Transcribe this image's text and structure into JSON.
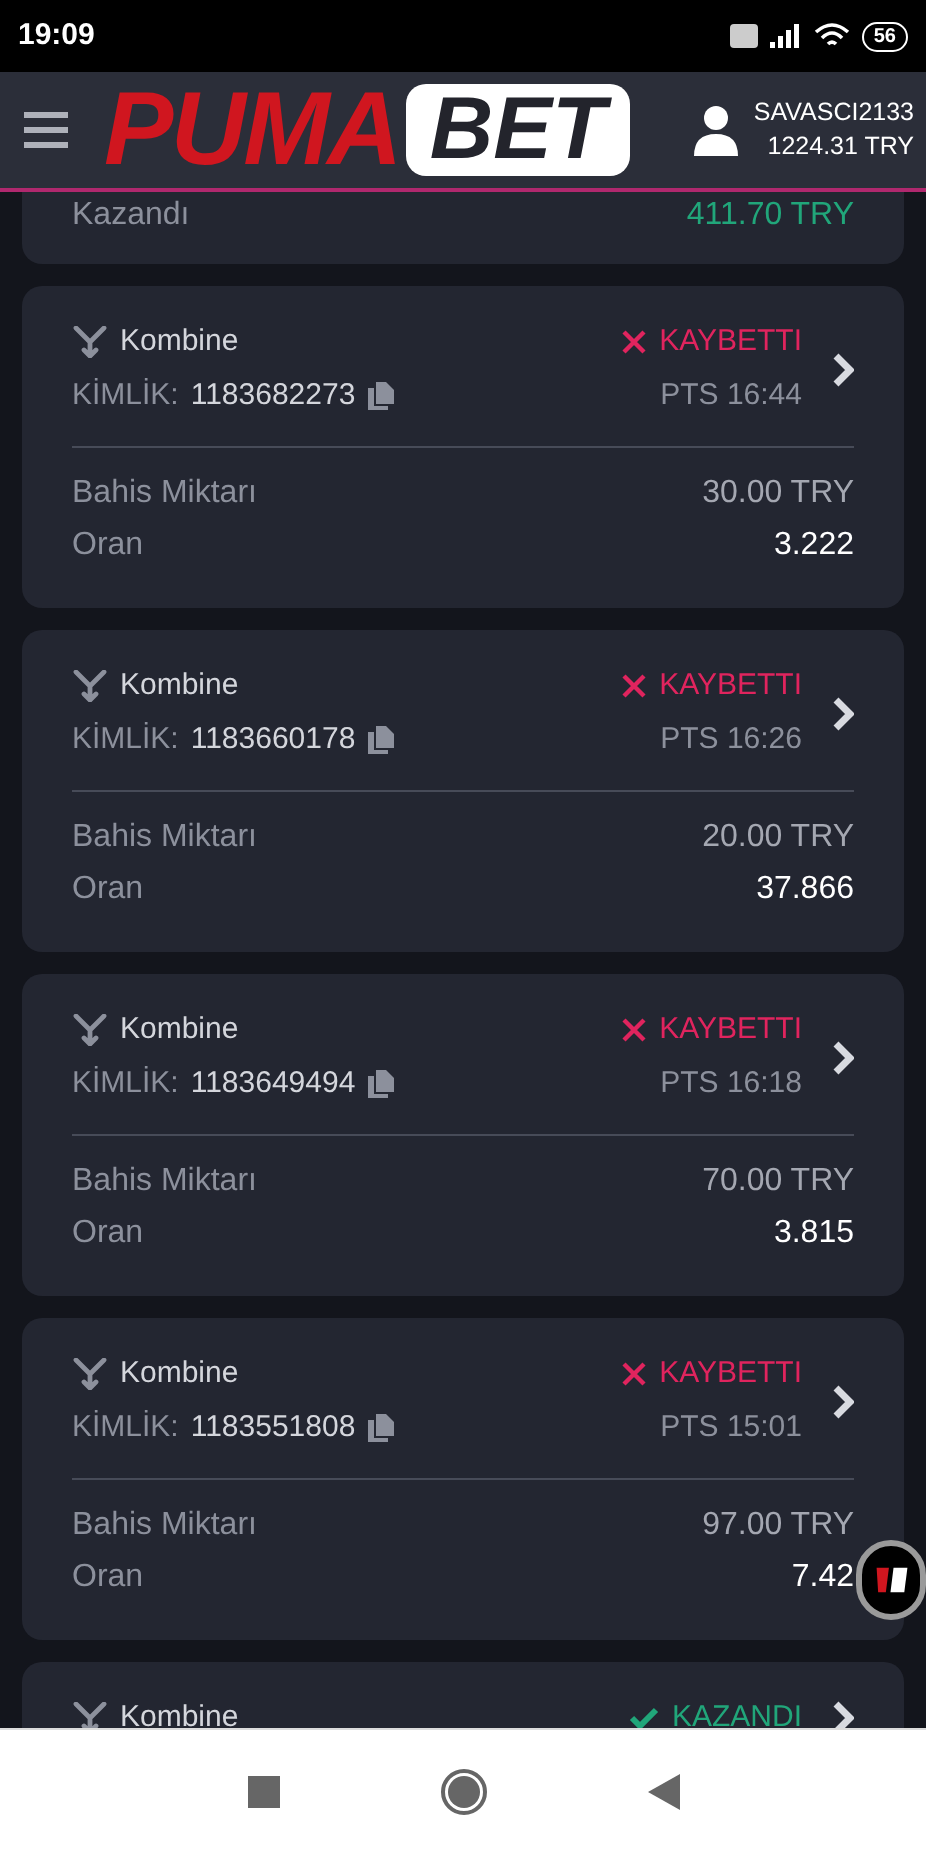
{
  "status_bar": {
    "time": "19:09",
    "battery": "56"
  },
  "header": {
    "logo_left": "PUMA",
    "logo_right": "BET",
    "username": "SAVASCI2133",
    "balance": "1224.31 TRY"
  },
  "previous_card": {
    "label": "Kazandı",
    "value": "411.70 TRY"
  },
  "bets": [
    {
      "type": "Kombine",
      "id_label": "KİMLİK:",
      "id": "1183682273",
      "kind": "lost",
      "status_text": "KAYBETTI",
      "time": "PTS 16:44",
      "stake_label": "Bahis Miktarı",
      "stake": "30.00 TRY",
      "odds_label": "Oran",
      "odds": "3.222"
    },
    {
      "type": "Kombine",
      "id_label": "KİMLİK:",
      "id": "1183660178",
      "kind": "lost",
      "status_text": "KAYBETTI",
      "time": "PTS 16:26",
      "stake_label": "Bahis Miktarı",
      "stake": "20.00 TRY",
      "odds_label": "Oran",
      "odds": "37.866"
    },
    {
      "type": "Kombine",
      "id_label": "KİMLİK:",
      "id": "1183649494",
      "kind": "lost",
      "status_text": "KAYBETTI",
      "time": "PTS 16:18",
      "stake_label": "Bahis Miktarı",
      "stake": "70.00 TRY",
      "odds_label": "Oran",
      "odds": "3.815"
    },
    {
      "type": "Kombine",
      "id_label": "KİMLİK:",
      "id": "1183551808",
      "kind": "lost",
      "status_text": "KAYBETTI",
      "time": "PTS 15:01",
      "stake_label": "Bahis Miktarı",
      "stake": "97.00 TRY",
      "odds_label": "Oran",
      "odds": "7.42"
    },
    {
      "type": "Kombine",
      "kind": "won",
      "status_text": "KAZANDI"
    }
  ]
}
